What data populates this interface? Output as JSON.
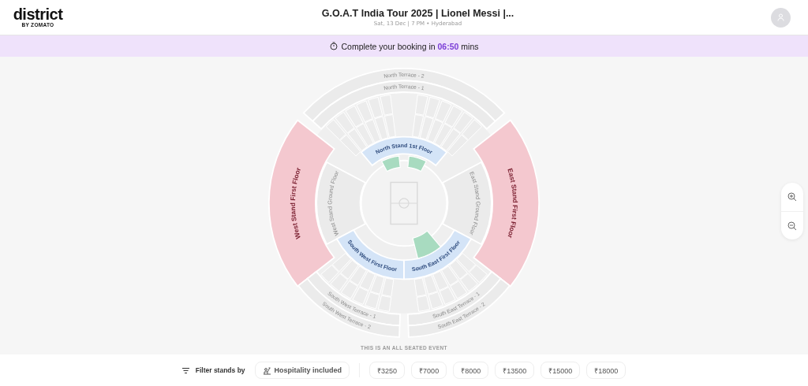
{
  "header": {
    "logo": {
      "word": "district",
      "sub": "BY ZOMATO"
    },
    "title": "G.O.A.T India Tour 2025 | Lionel Messi |...",
    "subtitle": "Sat, 13 Dec | 7 PM • Hyderabad"
  },
  "timer": {
    "prefix": "Complete your booking in",
    "time": "06:50",
    "suffix": "mins"
  },
  "map": {
    "sections": [
      {
        "label": "North Terrace - 2",
        "kind": "terrace"
      },
      {
        "label": "North Terrace - 1",
        "kind": "terrace"
      },
      {
        "label": "North Stand 1st Floor",
        "kind": "lounge"
      },
      {
        "label": "West Stand First Floor",
        "kind": "first_floor"
      },
      {
        "label": "West Stand Ground Floor",
        "kind": "ground_floor"
      },
      {
        "label": "East Stand Ground Floor",
        "kind": "ground_floor"
      },
      {
        "label": "East Stand First Floor",
        "kind": "first_floor"
      },
      {
        "label": "South West First Floor",
        "kind": "lounge"
      },
      {
        "label": "South East First Floor",
        "kind": "lounge"
      },
      {
        "label": "South West Terrace - 1",
        "kind": "terrace"
      },
      {
        "label": "South East Terrace - 1",
        "kind": "terrace"
      },
      {
        "label": "South West Terrace - 2",
        "kind": "terrace"
      },
      {
        "label": "South East Terrace - 2",
        "kind": "terrace"
      }
    ],
    "note": "THIS IS AN ALL SEATED EVENT"
  },
  "filter": {
    "label": "Filter stands by",
    "chips": [
      {
        "label": "Hospitality included",
        "kind": "hospitality"
      },
      {
        "label": "₹3250",
        "kind": "price"
      },
      {
        "label": "₹7000",
        "kind": "price"
      },
      {
        "label": "₹8000",
        "kind": "price"
      },
      {
        "label": "₹13500",
        "kind": "price"
      },
      {
        "label": "₹15000",
        "kind": "price"
      },
      {
        "label": "₹18000",
        "kind": "price"
      }
    ]
  }
}
